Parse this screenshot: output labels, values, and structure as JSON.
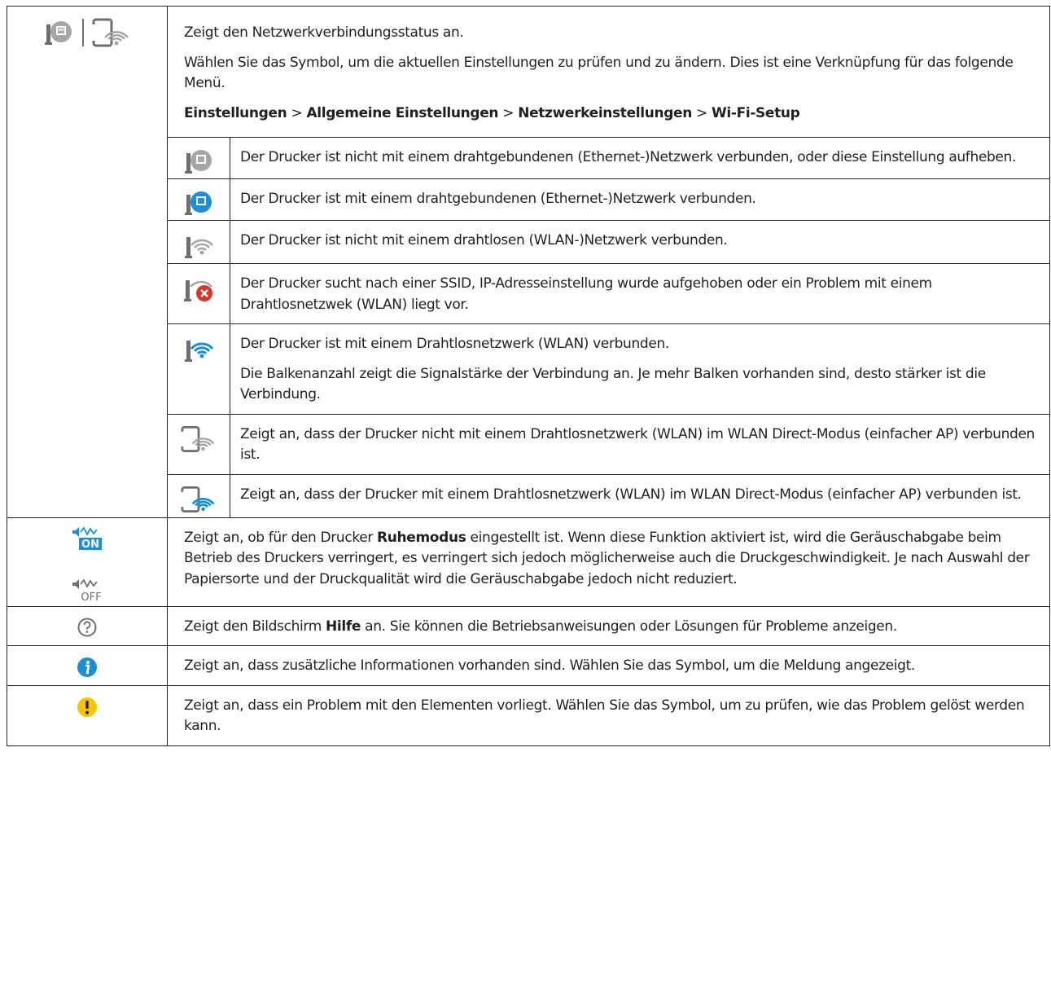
{
  "network": {
    "icons": [
      "ethernet-disconnected-icon",
      "wifi-direct-disconnected-icon"
    ],
    "intro": "Zeigt den Netzwerkverbindungsstatus an.",
    "detail": "Wählen Sie das Symbol, um die aktuellen Einstellungen zu prüfen und zu ändern. Dies ist eine Verknüpfung für das folgende Menü.",
    "path": {
      "p1": "Einstellungen",
      "sep": ">",
      "p2": "Allgemeine Einstellungen",
      "p3": "Netzwerkeinstellungen",
      "p4": "Wi-Fi-Setup"
    },
    "rows": [
      {
        "icon": "ethernet-disconnected-icon",
        "text": "Der Drucker ist nicht mit einem drahtgebundenen (Ethernet-)Netzwerk verbunden, oder diese Einstellung aufheben."
      },
      {
        "icon": "ethernet-connected-icon",
        "text": "Der Drucker ist mit einem drahtgebundenen (Ethernet-)Netzwerk verbunden."
      },
      {
        "icon": "wifi-disconnected-icon",
        "text": "Der Drucker ist nicht mit einem drahtlosen (WLAN-)Netzwerk verbunden."
      },
      {
        "icon": "wifi-error-icon",
        "text": "Der Drucker sucht nach einer SSID, IP-Adresseinstellung wurde aufgehoben oder ein Problem mit einem Drahtlosnetzwek (WLAN) liegt vor."
      },
      {
        "icon": "wifi-connected-icon",
        "text": "Der Drucker ist mit einem Drahtlosnetzwerk (WLAN) verbunden.",
        "text2": "Die Balkenanzahl zeigt die Signalstärke der Verbindung an. Je mehr Balken vorhanden sind, desto stärker ist die Verbindung."
      },
      {
        "icon": "wifi-direct-disconnected-icon",
        "text": "Zeigt an, dass der Drucker nicht mit einem Drahtlosnetzwerk (WLAN) im WLAN Direct-Modus (einfacher AP) verbunden ist."
      },
      {
        "icon": "wifi-direct-connected-icon",
        "text": "Zeigt an, dass der Drucker mit einem Drahtlosnetzwerk (WLAN) im WLAN Direct-Modus (einfacher AP) verbunden ist."
      }
    ]
  },
  "quiet": {
    "icon_on": "quiet-mode-on-icon",
    "icon_off": "quiet-mode-off-icon",
    "on_label": "ON",
    "off_label": "OFF",
    "t1": "Zeigt an, ob für den Drucker ",
    "bold": "Ruhemodus",
    "t2": " eingestellt ist. Wenn diese Funktion aktiviert ist, wird die Geräuschabgabe beim Betrieb des Druckers verringert, es verringert sich jedoch möglicherweise auch die Druckgeschwindigkeit. Je nach Auswahl der Papiersorte und der Druckqualität wird die Geräuschabgabe jedoch nicht reduziert."
  },
  "help": {
    "icon": "help-icon",
    "t1": "Zeigt den Bildschirm ",
    "bold": "Hilfe",
    "t2": " an. Sie können die Betriebsanweisungen oder Lösungen für Probleme anzeigen."
  },
  "info": {
    "icon": "info-icon",
    "text": "Zeigt an, dass zusätzliche Informationen vorhanden sind. Wählen Sie das Symbol, um die Meldung angezeigt."
  },
  "warning": {
    "icon": "warning-icon",
    "text": "Zeigt an, dass ein Problem mit den Elementen vorliegt. Wählen Sie das Symbol, um zu prüfen, wie das Problem gelöst werden kann."
  },
  "colors": {
    "border": "#231f20",
    "icon_gray": "#a6a6a6",
    "icon_blue": "#1b8ed6",
    "error_red": "#d9352b",
    "warning_yellow": "#f7c600"
  }
}
